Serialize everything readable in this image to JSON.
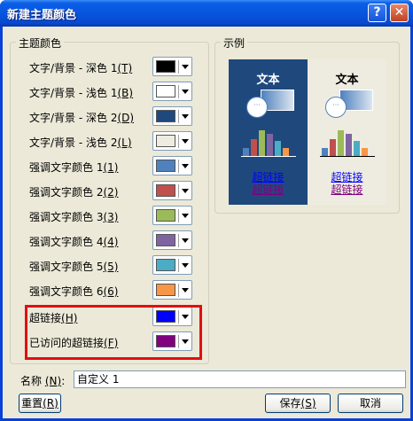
{
  "window": {
    "title": "新建主题颜色",
    "help_icon": "?",
    "close_icon": "✕"
  },
  "theme_group": {
    "title": "主题颜色"
  },
  "color_rows": [
    {
      "label": "文字/背景 - 深色 1",
      "key": "(T)",
      "color": "#000000"
    },
    {
      "label": "文字/背景 - 浅色 1",
      "key": "(B)",
      "color": "#ffffff"
    },
    {
      "label": "文字/背景 - 深色 2",
      "key": "(D)",
      "color": "#1f497d"
    },
    {
      "label": "文字/背景 - 浅色 2",
      "key": "(L)",
      "color": "#eeece1"
    },
    {
      "label": "强调文字颜色 1",
      "key": "(1)",
      "color": "#4f81bd"
    },
    {
      "label": "强调文字颜色 2",
      "key": "(2)",
      "color": "#c0504d"
    },
    {
      "label": "强调文字颜色 3",
      "key": "(3)",
      "color": "#9bbb59"
    },
    {
      "label": "强调文字颜色 4",
      "key": "(4)",
      "color": "#8064a2"
    },
    {
      "label": "强调文字颜色 5",
      "key": "(5)",
      "color": "#4bacc6"
    },
    {
      "label": "强调文字颜色 6",
      "key": "(6)",
      "color": "#f79646"
    },
    {
      "label": "超链接",
      "key": "(H)",
      "color": "#0000ff"
    },
    {
      "label": "已访问的超链接",
      "key": "(F)",
      "color": "#800080"
    }
  ],
  "sample": {
    "title": "示例",
    "text": "文本",
    "link": "超链接",
    "visited_link": "超链接"
  },
  "name_field": {
    "label": "名称",
    "key": "(N)",
    "value": "自定义 1"
  },
  "buttons": {
    "reset": {
      "label": "重置",
      "key": "(R)"
    },
    "save": {
      "label": "保存",
      "key": "(S)"
    },
    "cancel": "取消"
  }
}
